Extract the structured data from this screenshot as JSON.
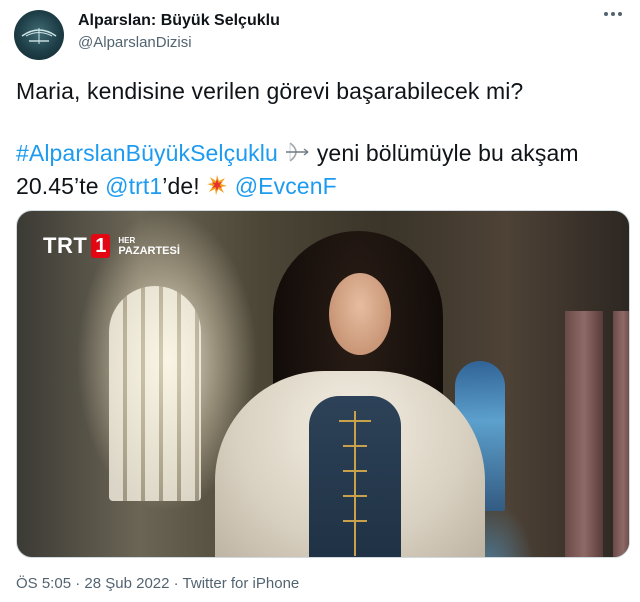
{
  "author": {
    "display_name": "Alparslan: Büyük Selçuklu",
    "handle": "@AlparslanDizisi"
  },
  "tweet": {
    "line1": "Maria, kendisine verilen görevi başarabilecek mi?",
    "hashtag": "#AlparslanBüyükSelçuklu",
    "line2_rest": " yeni bölümüyle bu akşam",
    "line3_prefix": "20.45’te ",
    "mention_trt": "@trt1",
    "line3_mid": "’de!",
    "mention_evcen": "@EvcenF"
  },
  "media": {
    "logo_text": "TRT",
    "logo_number": "1",
    "logo_small": "HER",
    "logo_big": "PAZARTESİ"
  },
  "meta": {
    "time": "ÖS 5:05",
    "date": "28 Şub 2022",
    "source": "Twitter for iPhone",
    "separator": " · "
  },
  "icons": {
    "more": "more-icon",
    "bow_emoji": "bow-and-arrow-icon",
    "collision_emoji": "collision-icon"
  },
  "colors": {
    "link": "#1d9bf0",
    "text": "#0f1419",
    "muted": "#536471",
    "trt_red": "#e30613"
  }
}
